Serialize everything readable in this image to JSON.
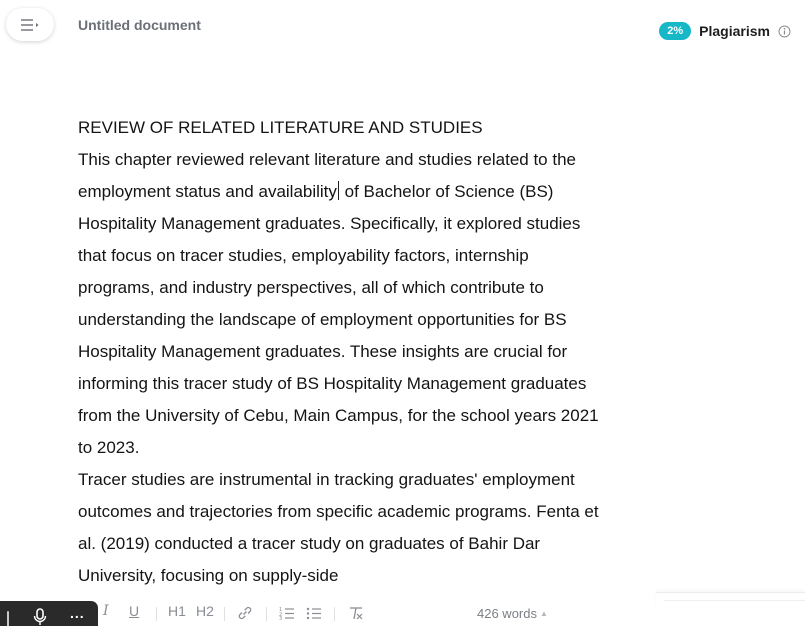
{
  "header": {
    "document_title": "Untitled document",
    "plagiarism_badge": "2%",
    "plagiarism_label": "Plagiarism"
  },
  "document": {
    "heading": "REVIEW OF RELATED LITERATURE AND STUDIES",
    "paragraph1_before_caret": "This chapter reviewed relevant literature and studies related to the employment status and availability",
    "paragraph1_after_caret": " of Bachelor of Science (BS) Hospitality Management graduates. Specifically, it explored studies that focus on tracer studies, employability factors, internship programs, and industry perspectives, all of which contribute to understanding the landscape of employment opportunities for BS Hospitality Management graduates. These insights are crucial for informing this tracer study of BS Hospitality Management graduates from the University of Cebu, Main Campus, for the school years 2021 to 2023.",
    "paragraph2": "Tracer studies are instrumental in tracking graduates' employment outcomes and trajectories from specific academic programs. Fenta et al. (2019) conducted a tracer study on graduates of Bahir Dar University, focusing on supply-side"
  },
  "toolbar": {
    "more": "...",
    "italic": "I",
    "underline": "U",
    "h1": "H1",
    "h2": "H2",
    "word_count": "426 words",
    "icons": [
      "menu-icon",
      "mic-icon",
      "link-icon",
      "numbered-list-icon",
      "bullet-list-icon",
      "clear-format-icon",
      "info-icon"
    ]
  },
  "colors": {
    "accent": "#16b7c7",
    "toolbar_dark": "#2a2a2a",
    "muted_text": "#6b6f77"
  }
}
